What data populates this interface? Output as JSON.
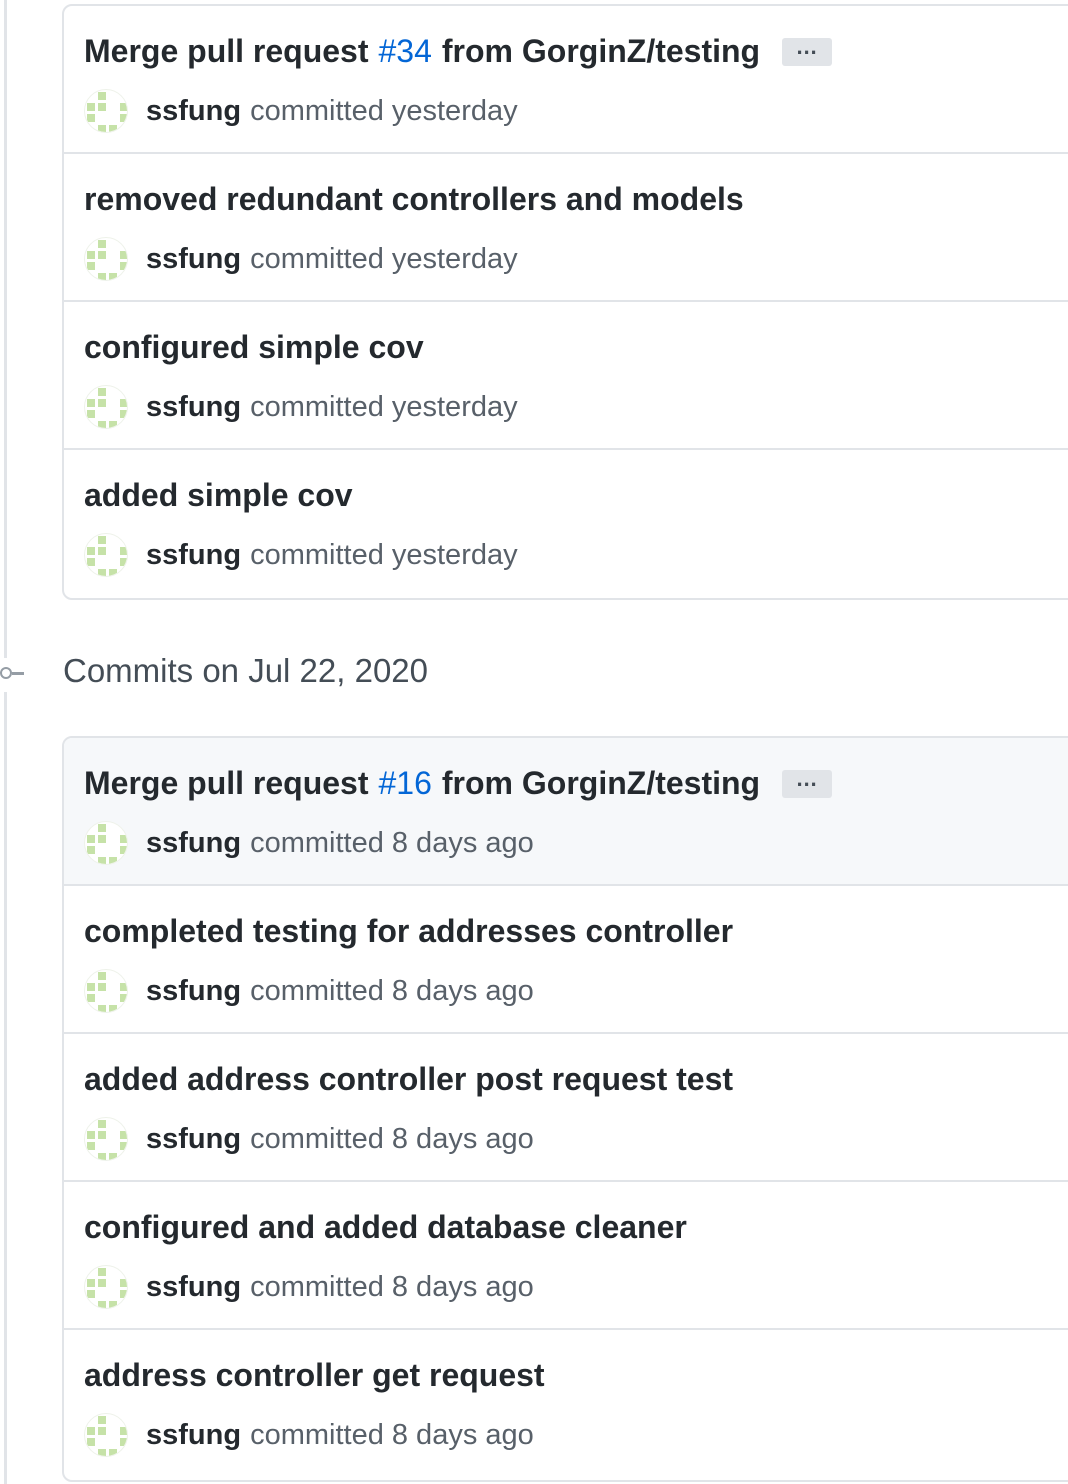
{
  "groups": [
    {
      "commits": [
        {
          "message_pre": "Merge pull request ",
          "pr": "#34",
          "message_post": " from GorginZ/testing",
          "has_ellipsis": true,
          "author": "ssfung",
          "committed_text": "committed yesterday"
        },
        {
          "message": "removed redundant controllers and models",
          "author": "ssfung",
          "committed_text": "committed yesterday"
        },
        {
          "message": "configured simple cov",
          "author": "ssfung",
          "committed_text": "committed yesterday"
        },
        {
          "message": "added simple cov",
          "author": "ssfung",
          "committed_text": "committed yesterday"
        }
      ]
    },
    {
      "heading": "Commits on Jul 22, 2020",
      "commits": [
        {
          "message_pre": "Merge pull request ",
          "pr": "#16",
          "message_post": " from GorginZ/testing",
          "has_ellipsis": true,
          "author": "ssfung",
          "committed_text": "committed 8 days ago"
        },
        {
          "message": "completed testing for addresses controller",
          "author": "ssfung",
          "committed_text": "committed 8 days ago"
        },
        {
          "message": "added address controller post request test",
          "author": "ssfung",
          "committed_text": "committed 8 days ago"
        },
        {
          "message": "configured and added database cleaner",
          "author": "ssfung",
          "committed_text": "committed 8 days ago"
        },
        {
          "message": "address controller get request",
          "author": "ssfung",
          "committed_text": "committed 8 days ago"
        }
      ]
    }
  ],
  "icons": {
    "ellipsis": "…",
    "avatar": "identicon",
    "timeline_node": "git-commit-icon"
  },
  "colors": {
    "link": "#0366d6",
    "avatar_pattern": "#c6e2a8",
    "highlight_row": "#f6f8fa"
  }
}
